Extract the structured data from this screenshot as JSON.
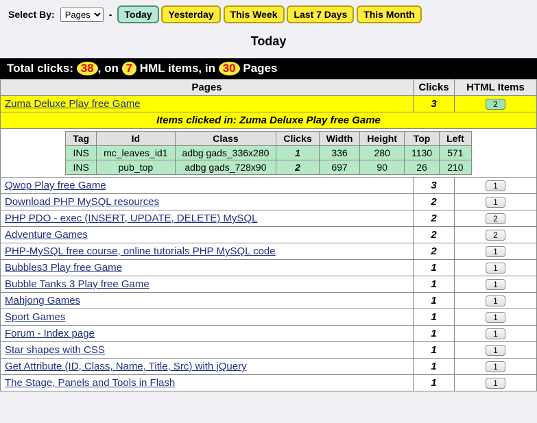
{
  "toolbar": {
    "select_by_label": "Select By:",
    "select_value": "Pages",
    "sep": "-",
    "buttons": [
      "Today",
      "Yesterday",
      "This Week",
      "Last 7 Days",
      "This Month"
    ],
    "active_index": 0
  },
  "title": "Today",
  "summary": {
    "prefix": "Total clicks: ",
    "clicks": "38",
    "mid1": ", on ",
    "items": "7",
    "mid2": " HML items, in ",
    "pages": "30",
    "suffix": " Pages"
  },
  "headers": {
    "pages": "Pages",
    "clicks": "Clicks",
    "html_items": "HTML Items"
  },
  "detail": {
    "row": {
      "page": "Zuma Deluxe Play free Game",
      "clicks": "3",
      "items": "2"
    },
    "header_prefix": "Items clicked in: ",
    "header_page": "Zuma Deluxe Play free Game",
    "cols": [
      "Tag",
      "Id",
      "Class",
      "Clicks",
      "Width",
      "Height",
      "Top",
      "Left"
    ],
    "rows": [
      {
        "tag": "INS",
        "id": "mc_leaves_id1",
        "class": "adbg gads_336x280",
        "clicks": "1",
        "width": "336",
        "height": "280",
        "top": "1130",
        "left": "571"
      },
      {
        "tag": "INS",
        "id": "pub_top",
        "class": "adbg gads_728x90",
        "clicks": "2",
        "width": "697",
        "height": "90",
        "top": "26",
        "left": "210"
      }
    ]
  },
  "rows": [
    {
      "page": "Qwop Play free Game",
      "clicks": "3",
      "items": "1"
    },
    {
      "page": "Download PHP MySQL resources",
      "clicks": "2",
      "items": "1"
    },
    {
      "page": "PHP PDO - exec (INSERT, UPDATE, DELETE) MySQL",
      "clicks": "2",
      "items": "2"
    },
    {
      "page": "Adventure Games",
      "clicks": "2",
      "items": "2"
    },
    {
      "page": "PHP-MySQL free course, online tutorials PHP MySQL code",
      "clicks": "2",
      "items": "1"
    },
    {
      "page": "Bubbles3 Play free Game",
      "clicks": "1",
      "items": "1"
    },
    {
      "page": "Bubble Tanks 3 Play free Game",
      "clicks": "1",
      "items": "1"
    },
    {
      "page": "Mahjong Games",
      "clicks": "1",
      "items": "1"
    },
    {
      "page": "Sport Games",
      "clicks": "1",
      "items": "1"
    },
    {
      "page": "Forum - Index page",
      "clicks": "1",
      "items": "1"
    },
    {
      "page": "Star shapes with CSS",
      "clicks": "1",
      "items": "1"
    },
    {
      "page": "Get Attribute (ID, Class, Name, Title, Src) with jQuery",
      "clicks": "1",
      "items": "1"
    },
    {
      "page": "The Stage, Panels and Tools in Flash",
      "clicks": "1",
      "items": "1"
    }
  ]
}
